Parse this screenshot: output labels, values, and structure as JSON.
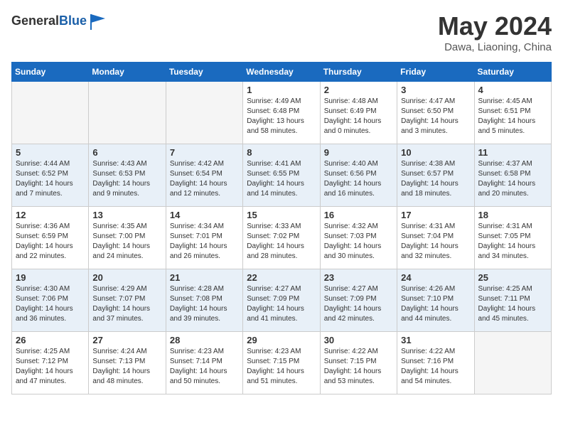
{
  "header": {
    "logo_general": "General",
    "logo_blue": "Blue",
    "month_title": "May 2024",
    "location": "Dawa, Liaoning, China"
  },
  "days_of_week": [
    "Sunday",
    "Monday",
    "Tuesday",
    "Wednesday",
    "Thursday",
    "Friday",
    "Saturday"
  ],
  "weeks": [
    [
      {
        "day": null,
        "empty": true
      },
      {
        "day": null,
        "empty": true
      },
      {
        "day": null,
        "empty": true
      },
      {
        "day": "1",
        "sunrise": "4:49 AM",
        "sunset": "6:48 PM",
        "daylight": "13 hours and 58 minutes."
      },
      {
        "day": "2",
        "sunrise": "4:48 AM",
        "sunset": "6:49 PM",
        "daylight": "14 hours and 0 minutes."
      },
      {
        "day": "3",
        "sunrise": "4:47 AM",
        "sunset": "6:50 PM",
        "daylight": "14 hours and 3 minutes."
      },
      {
        "day": "4",
        "sunrise": "4:45 AM",
        "sunset": "6:51 PM",
        "daylight": "14 hours and 5 minutes."
      }
    ],
    [
      {
        "day": "5",
        "sunrise": "4:44 AM",
        "sunset": "6:52 PM",
        "daylight": "14 hours and 7 minutes."
      },
      {
        "day": "6",
        "sunrise": "4:43 AM",
        "sunset": "6:53 PM",
        "daylight": "14 hours and 9 minutes."
      },
      {
        "day": "7",
        "sunrise": "4:42 AM",
        "sunset": "6:54 PM",
        "daylight": "14 hours and 12 minutes."
      },
      {
        "day": "8",
        "sunrise": "4:41 AM",
        "sunset": "6:55 PM",
        "daylight": "14 hours and 14 minutes."
      },
      {
        "day": "9",
        "sunrise": "4:40 AM",
        "sunset": "6:56 PM",
        "daylight": "14 hours and 16 minutes."
      },
      {
        "day": "10",
        "sunrise": "4:38 AM",
        "sunset": "6:57 PM",
        "daylight": "14 hours and 18 minutes."
      },
      {
        "day": "11",
        "sunrise": "4:37 AM",
        "sunset": "6:58 PM",
        "daylight": "14 hours and 20 minutes."
      }
    ],
    [
      {
        "day": "12",
        "sunrise": "4:36 AM",
        "sunset": "6:59 PM",
        "daylight": "14 hours and 22 minutes."
      },
      {
        "day": "13",
        "sunrise": "4:35 AM",
        "sunset": "7:00 PM",
        "daylight": "14 hours and 24 minutes."
      },
      {
        "day": "14",
        "sunrise": "4:34 AM",
        "sunset": "7:01 PM",
        "daylight": "14 hours and 26 minutes."
      },
      {
        "day": "15",
        "sunrise": "4:33 AM",
        "sunset": "7:02 PM",
        "daylight": "14 hours and 28 minutes."
      },
      {
        "day": "16",
        "sunrise": "4:32 AM",
        "sunset": "7:03 PM",
        "daylight": "14 hours and 30 minutes."
      },
      {
        "day": "17",
        "sunrise": "4:31 AM",
        "sunset": "7:04 PM",
        "daylight": "14 hours and 32 minutes."
      },
      {
        "day": "18",
        "sunrise": "4:31 AM",
        "sunset": "7:05 PM",
        "daylight": "14 hours and 34 minutes."
      }
    ],
    [
      {
        "day": "19",
        "sunrise": "4:30 AM",
        "sunset": "7:06 PM",
        "daylight": "14 hours and 36 minutes."
      },
      {
        "day": "20",
        "sunrise": "4:29 AM",
        "sunset": "7:07 PM",
        "daylight": "14 hours and 37 minutes."
      },
      {
        "day": "21",
        "sunrise": "4:28 AM",
        "sunset": "7:08 PM",
        "daylight": "14 hours and 39 minutes."
      },
      {
        "day": "22",
        "sunrise": "4:27 AM",
        "sunset": "7:09 PM",
        "daylight": "14 hours and 41 minutes."
      },
      {
        "day": "23",
        "sunrise": "4:27 AM",
        "sunset": "7:09 PM",
        "daylight": "14 hours and 42 minutes."
      },
      {
        "day": "24",
        "sunrise": "4:26 AM",
        "sunset": "7:10 PM",
        "daylight": "14 hours and 44 minutes."
      },
      {
        "day": "25",
        "sunrise": "4:25 AM",
        "sunset": "7:11 PM",
        "daylight": "14 hours and 45 minutes."
      }
    ],
    [
      {
        "day": "26",
        "sunrise": "4:25 AM",
        "sunset": "7:12 PM",
        "daylight": "14 hours and 47 minutes."
      },
      {
        "day": "27",
        "sunrise": "4:24 AM",
        "sunset": "7:13 PM",
        "daylight": "14 hours and 48 minutes."
      },
      {
        "day": "28",
        "sunrise": "4:23 AM",
        "sunset": "7:14 PM",
        "daylight": "14 hours and 50 minutes."
      },
      {
        "day": "29",
        "sunrise": "4:23 AM",
        "sunset": "7:15 PM",
        "daylight": "14 hours and 51 minutes."
      },
      {
        "day": "30",
        "sunrise": "4:22 AM",
        "sunset": "7:15 PM",
        "daylight": "14 hours and 53 minutes."
      },
      {
        "day": "31",
        "sunrise": "4:22 AM",
        "sunset": "7:16 PM",
        "daylight": "14 hours and 54 minutes."
      },
      {
        "day": null,
        "empty": true
      }
    ]
  ]
}
